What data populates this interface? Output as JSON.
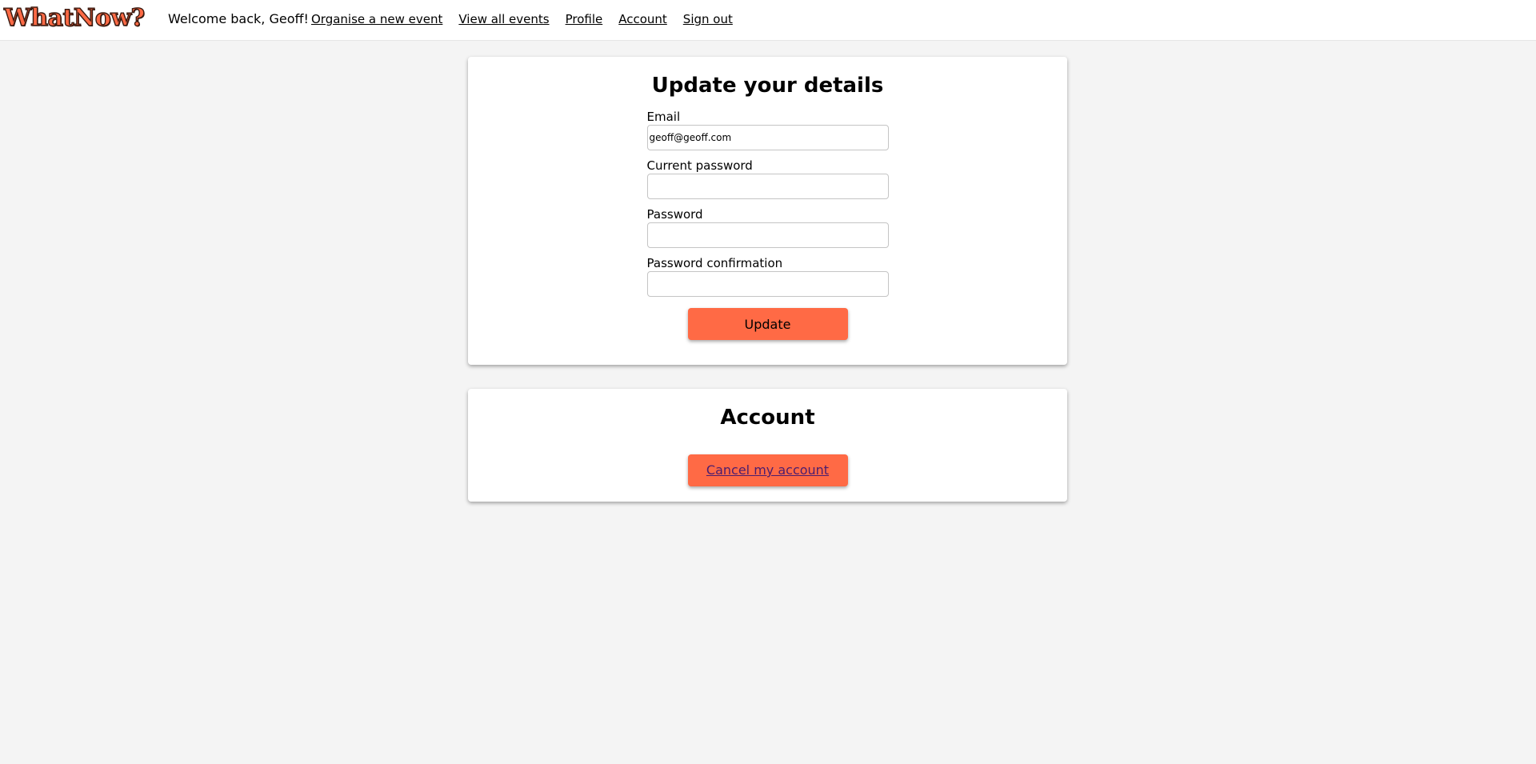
{
  "nav": {
    "logo": "WhatNow?",
    "welcome": "Welcome back, Geoff!",
    "links": [
      {
        "label": "Organise a new event"
      },
      {
        "label": "View all events"
      },
      {
        "label": "Profile"
      },
      {
        "label": "Account"
      },
      {
        "label": "Sign out"
      }
    ]
  },
  "details": {
    "title": "Update your details",
    "email_label": "Email",
    "email_value": "geoff@geoff.com",
    "current_password_label": "Current password",
    "password_label": "Password",
    "password_confirmation_label": "Password confirmation",
    "update_button": "Update"
  },
  "account": {
    "title": "Account",
    "cancel_link": "Cancel my account"
  },
  "colors": {
    "accent": "#ff6a45",
    "background": "#f4f4f4",
    "link_visited": "#4b1d6f"
  }
}
